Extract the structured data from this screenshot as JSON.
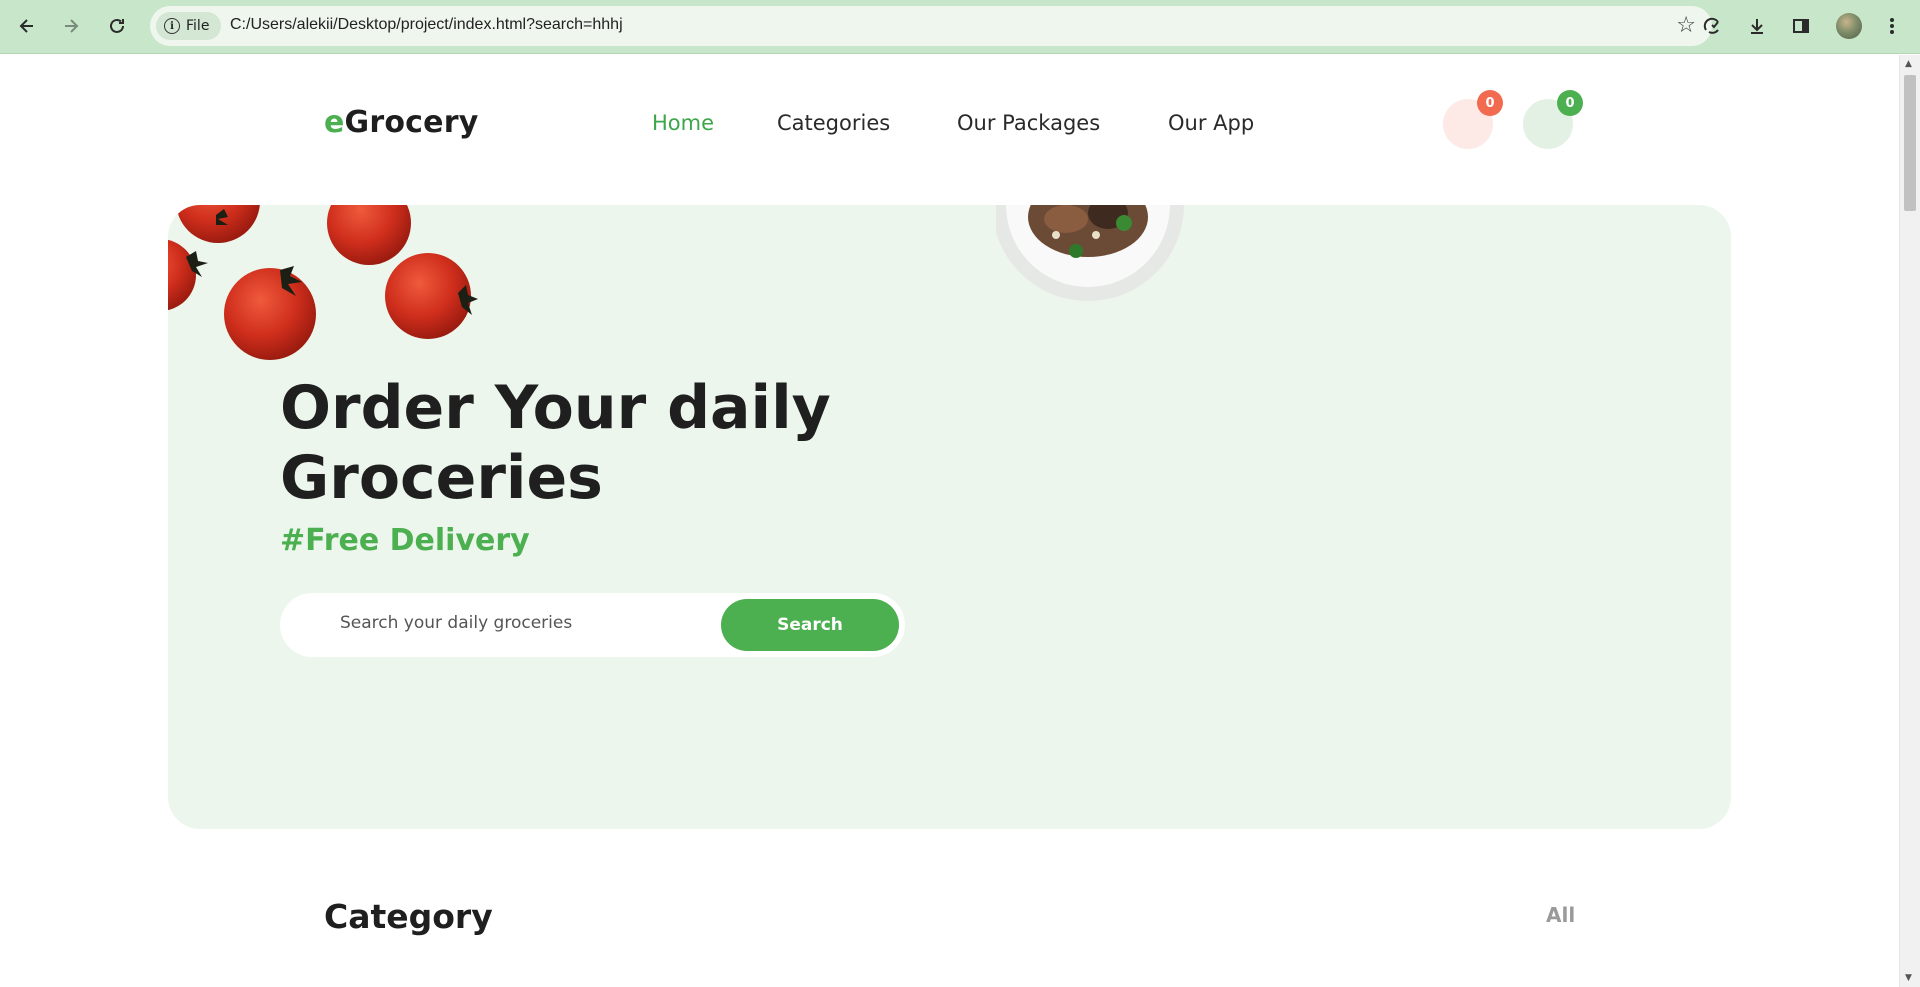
{
  "browser": {
    "chip_label": "File",
    "url": "C:/Users/alekii/Desktop/project/index.html?search=hhhj",
    "icons": [
      "back-arrow-icon",
      "forward-arrow-icon",
      "reload-icon",
      "info-icon",
      "star-icon",
      "performance-icon",
      "download-icon",
      "side-panel-icon",
      "profile-avatar",
      "more-menu-icon"
    ]
  },
  "header": {
    "logo_accent": "e",
    "logo_rest": "Grocery",
    "nav": [
      "Home",
      "Categories",
      "Our Packages",
      "Our App"
    ],
    "active_nav": "Home",
    "wishlist_count": "0",
    "cart_count": "0"
  },
  "hero": {
    "title_line1": "Order Your daily",
    "title_line2": "Groceries",
    "subtitle": "#Free Delivery",
    "search_placeholder": "Search your daily groceries",
    "search_button": "Search"
  },
  "category": {
    "title": "Category",
    "all_label": "All"
  },
  "colors": {
    "brand_green": "#4caf50",
    "hero_bg": "#ecf6ed",
    "badge_red": "#f26a4f",
    "chrome_bg": "#c8e6c9"
  }
}
